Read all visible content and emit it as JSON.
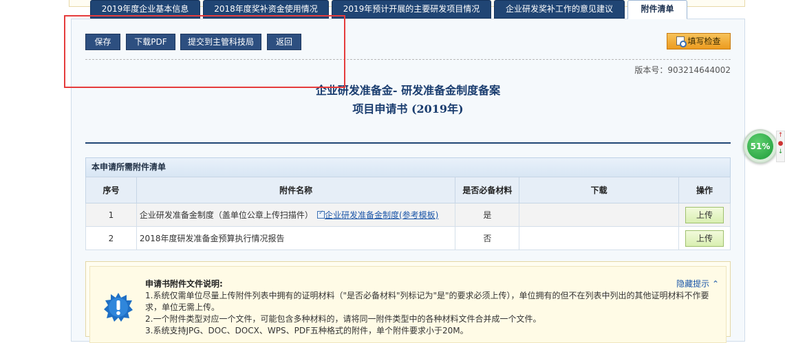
{
  "toolbar": {
    "save": "保存",
    "download_pdf": "下载PDF",
    "submit": "提交到主管科技局",
    "back": "返回",
    "check": "填写检查"
  },
  "version": "版本号：903214644002",
  "title_line1": "企业研发准备金- 研发准备金制度备案",
  "title_line2": "项目申请书 (2019年)",
  "tabs": [
    {
      "label": "2019年度企业基本信息"
    },
    {
      "label": "2018年度奖补资金使用情况"
    },
    {
      "label": "2019年预计开展的主要研发项目情况"
    },
    {
      "label": "企业研发奖补工作的意见建议"
    },
    {
      "label": "附件清单",
      "active": true
    }
  ],
  "section_title": "本申请所需附件清单",
  "table": {
    "headers": [
      "序号",
      "附件名称",
      "是否必备材料",
      "下载",
      "操作"
    ],
    "rows": [
      {
        "no": "1",
        "name": "企业研发准备金制度（盖单位公章上传扫描件）",
        "template": "企业研发准备金制度(参考模板)",
        "required": "是",
        "download": "",
        "action": "上传"
      },
      {
        "no": "2",
        "name": "2018年度研发准备金预算执行情况报告",
        "template": "",
        "required": "否",
        "download": "",
        "action": "上传"
      }
    ]
  },
  "notice": {
    "title": "申请书附件文件说明:",
    "hide": "隐藏提示",
    "lines": [
      "1.系统仅需单位尽量上传附件列表中拥有的证明材料（\"是否必备材料\"列标记为\"是\"的要求必须上传），单位拥有的但不在列表中列出的其他证明材料不作要求，单位无需上传。",
      "2.一个附件类型对应一个文件，可能包含多种材料的，请将同一附件类型中的各种材料文件合并成一个文件。",
      "3.系统支持JPG、DOC、DOCX、WPS、PDF五种格式的附件，单个附件要求小于20M。"
    ]
  },
  "gauge": {
    "value": "51%"
  },
  "colors": {
    "tab_bg": "#204574",
    "highlight_box": "#e53b3b",
    "check_button": "#ec9b1f"
  }
}
